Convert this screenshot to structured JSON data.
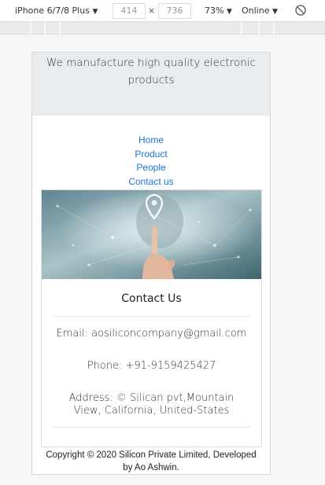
{
  "devtools": {
    "device": "iPhone 6/7/8 Plus",
    "width": "414",
    "height": "736",
    "times": "×",
    "zoom": "73%",
    "network": "Online",
    "dropdown_icon": "▼"
  },
  "banner": {
    "text": "We manufacture high quality electronic products"
  },
  "nav": {
    "items": [
      "Home",
      "Product",
      "People",
      "Contact us"
    ]
  },
  "contact": {
    "title": "Contact Us",
    "email": "Email: aosiliconcompany@gmail.com",
    "phone": "Phone: +91-9159425427",
    "address_line1": "Address: © Silican pvt,Mountain",
    "address_line2": "View, California, United-States"
  },
  "footer": {
    "line1": "Copyright © 2020 Silicon Private Limited, Developed",
    "line2": "by Ao Ashwin."
  },
  "colors": {
    "link": "#1a73d9",
    "banner_bg": "#e9ecef"
  }
}
